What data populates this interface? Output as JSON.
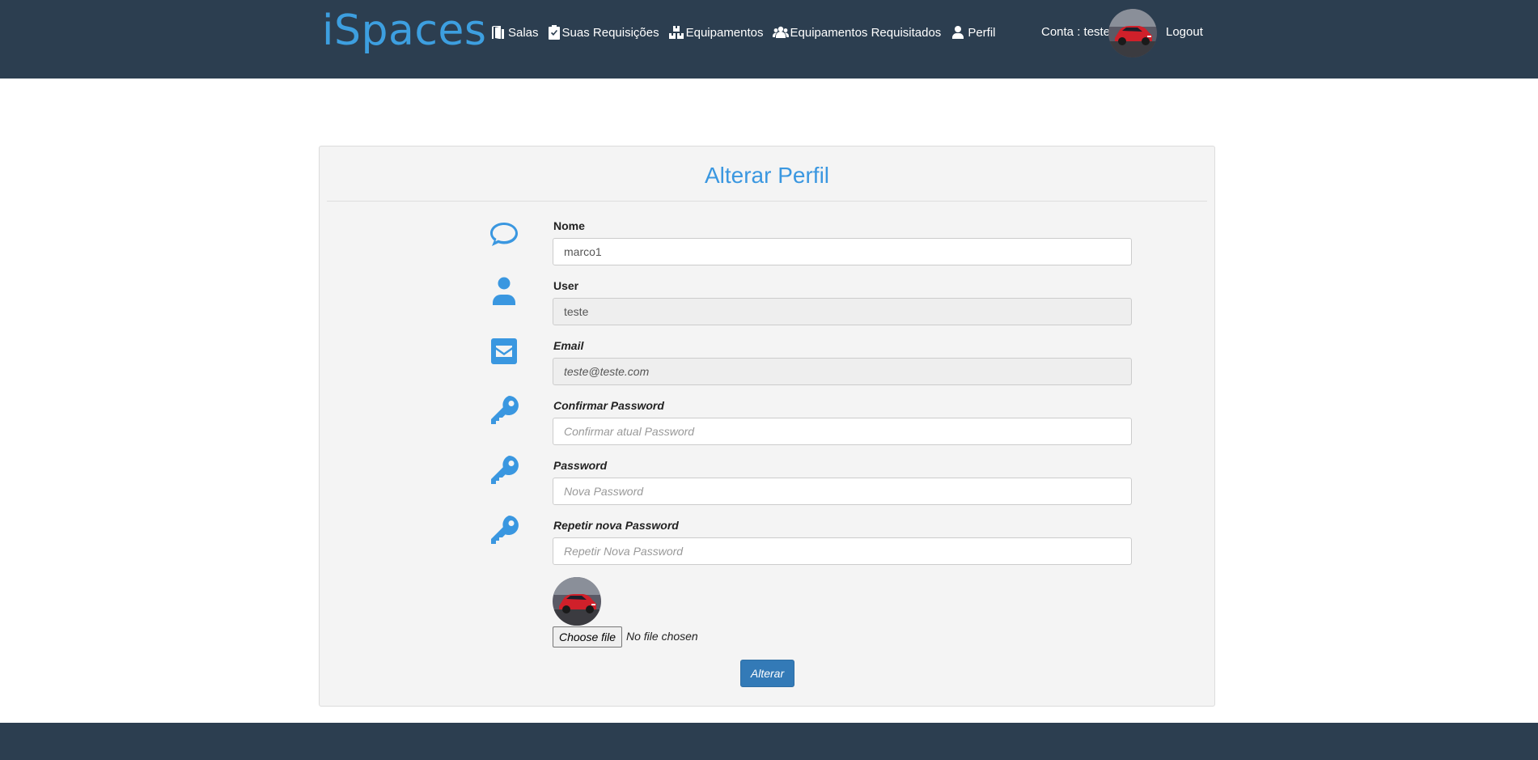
{
  "header": {
    "brand": "iSpaces",
    "nav": [
      {
        "label": "Salas",
        "icon": "door-icon"
      },
      {
        "label": "Suas Requisições",
        "icon": "clipboard-check-icon"
      },
      {
        "label": "Equipamentos",
        "icon": "boxes-icon"
      },
      {
        "label": "Equipamentos Requisitados",
        "icon": "users-icon"
      },
      {
        "label": "Perfil",
        "icon": "user-icon"
      }
    ],
    "account": "Conta : teste",
    "logout": "Logout"
  },
  "form": {
    "title": "Alterar Perfil",
    "fields": [
      {
        "label": "Nome",
        "value": "marco1",
        "placeholder": "",
        "icon": "comment-icon"
      },
      {
        "label": "User",
        "value": "teste",
        "placeholder": "",
        "icon": "user-icon"
      },
      {
        "label": "Email",
        "value": "teste@teste.com",
        "placeholder": "",
        "icon": "envelope-icon"
      },
      {
        "label": "Confirmar Password",
        "value": "",
        "placeholder": "Confirmar atual Password",
        "icon": "key-icon"
      },
      {
        "label": "Password",
        "value": "",
        "placeholder": "Nova Password",
        "icon": "key-icon"
      },
      {
        "label": "Repetir nova Password",
        "value": "",
        "placeholder": "Repetir Nova Password",
        "icon": "key-icon"
      }
    ],
    "file_button": "Choose file",
    "file_status": "No file chosen",
    "submit": "Alterar"
  },
  "colors": {
    "navbar": "#2c3e50",
    "brand": "#3d9fe0",
    "accent": "#3a97e0",
    "button": "#337ab7"
  }
}
